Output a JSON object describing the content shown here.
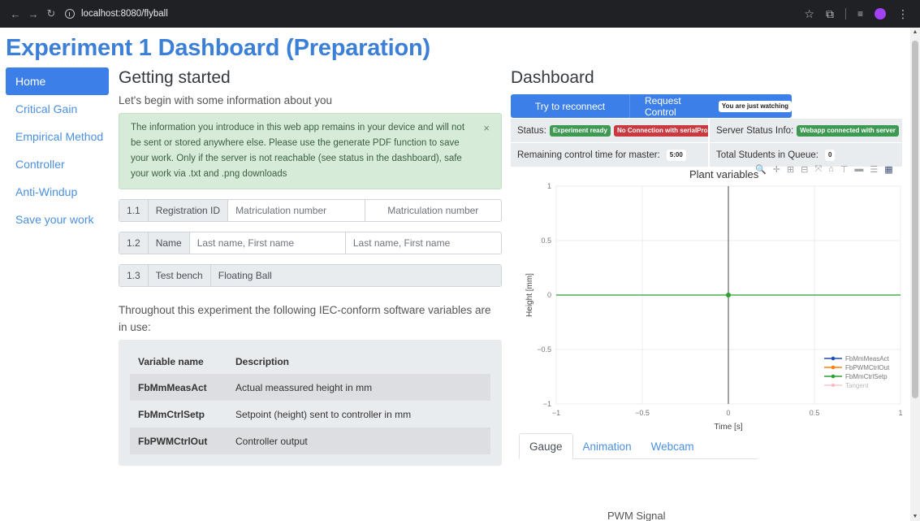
{
  "browser": {
    "back_icon": "arrow-left-icon",
    "url": "localhost:8080/flyball"
  },
  "page": {
    "title": "Experiment 1 Dashboard (Preparation)"
  },
  "sidebar": {
    "items": [
      {
        "label": "Home",
        "active": true
      },
      {
        "label": "Critical Gain"
      },
      {
        "label": "Empirical Method"
      },
      {
        "label": "Controller"
      },
      {
        "label": "Anti-Windup"
      },
      {
        "label": "Save your work"
      }
    ]
  },
  "main": {
    "heading": "Getting started",
    "lead": "Let's begin with some information about you",
    "alert": {
      "text": "The information you introduce in this web app remains in your device and will not be sent or stored anywhere else. Please use the generate PDF function to save your work. Only if the server is not reachable (see status in the dashboard), safe your work via .txt and .png downloads",
      "close": "×"
    },
    "form": {
      "registration": {
        "num": "1.1",
        "label": "Registration ID",
        "placeholder1": "Matriculation number",
        "placeholder2": "Matriculation number"
      },
      "name": {
        "num": "1.2",
        "label": "Name",
        "placeholder1": "Last name, First name",
        "placeholder2": "Last name, First name"
      },
      "testbench": {
        "num": "1.3",
        "label": "Test bench",
        "value": "Floating Ball"
      }
    },
    "variables_intro": "Throughout this experiment the following IEC-conform software variables are in use:",
    "variables": {
      "headers": [
        "Variable name",
        "Description"
      ],
      "rows": [
        {
          "name": "FbMmMeasAct",
          "desc": "Actual meassured height in mm"
        },
        {
          "name": "FbMmCtrlSetp",
          "desc": "Setpoint (height) sent to controller in mm"
        },
        {
          "name": "FbPWMCtrlOut",
          "desc": "Controller output"
        }
      ]
    }
  },
  "dashboard": {
    "heading": "Dashboard",
    "reconnect_label": "Try to reconnect",
    "request_label": "Request Control",
    "watching_badge": "You are just watching",
    "status_label": "Status:",
    "status_badge1": "Experiment ready",
    "status_badge2": "No Connection with serialProxy",
    "server_label": "Server Status Info:",
    "server_badge": "Webapp connected with server",
    "remaining_label": "Remaining control time for master:",
    "remaining_value": "5:00",
    "queue_label": "Total Students in Queue:",
    "queue_value": "0"
  },
  "plot": {
    "title": "Plant variables",
    "modebar_icons": [
      "zoom-icon",
      "pan-icon",
      "zoom-in-icon",
      "zoom-out-icon",
      "autoscale-icon",
      "home-icon",
      "spike-lines-icon",
      "hover-closest-icon",
      "hover-compare-icon",
      "plotly-logo-icon"
    ]
  },
  "chart_data": {
    "type": "line",
    "xlabel": "Time [s]",
    "ylabel": "Height [mm]",
    "xlim": [
      -1,
      1
    ],
    "ylim": [
      -1,
      1
    ],
    "x_ticks": [
      "−1",
      "−0.5",
      "0",
      "0.5",
      "1"
    ],
    "y_ticks": [
      "1",
      "0.5",
      "0",
      "−0.5",
      "−1"
    ],
    "grid": true,
    "legend_position": "bottom-right",
    "series": [
      {
        "name": "FbMmMeasAct",
        "color": "#1f4fb4",
        "x": [],
        "y": []
      },
      {
        "name": "FbPWMCtrlOut",
        "color": "#ff7f0e",
        "x": [],
        "y": []
      },
      {
        "name": "FbMmCtrlSetp",
        "color": "#2ca02c",
        "x": [
          0
        ],
        "y": [
          0
        ]
      },
      {
        "name": "Tangent",
        "color": "#f4a6b0",
        "x": [],
        "y": []
      }
    ]
  },
  "tabs": [
    {
      "label": "Gauge",
      "active": true
    },
    {
      "label": "Animation"
    },
    {
      "label": "Webcam"
    }
  ],
  "pwm_title": "PWM Signal"
}
